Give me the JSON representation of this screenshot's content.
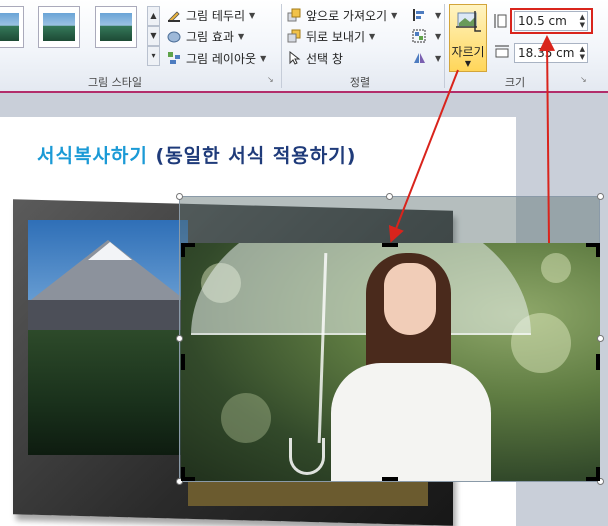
{
  "ribbon": {
    "picture_style_group": {
      "label": "그림 스타일",
      "border_label": "그림 테두리",
      "effects_label": "그림 효과",
      "layout_label": "그림 레이아웃"
    },
    "arrange_group": {
      "label": "정렬",
      "bring_forward_label": "앞으로 가져오기",
      "send_backward_label": "뒤로 보내기",
      "selection_pane_label": "선택 창"
    },
    "size_group": {
      "label": "크기",
      "crop_label": "자르기",
      "height_value": "10.5 cm",
      "width_value": "18.35 cm"
    }
  },
  "slide": {
    "title_part1": "서식복사하기",
    "title_part2": "(동일한 서식 적용하기)"
  },
  "colors": {
    "accent_highlight": "#d9241c",
    "title_blue": "#1b9ad6",
    "title_navy": "#1f3b7a",
    "ribbon_tab_border": "#b22d6a"
  }
}
